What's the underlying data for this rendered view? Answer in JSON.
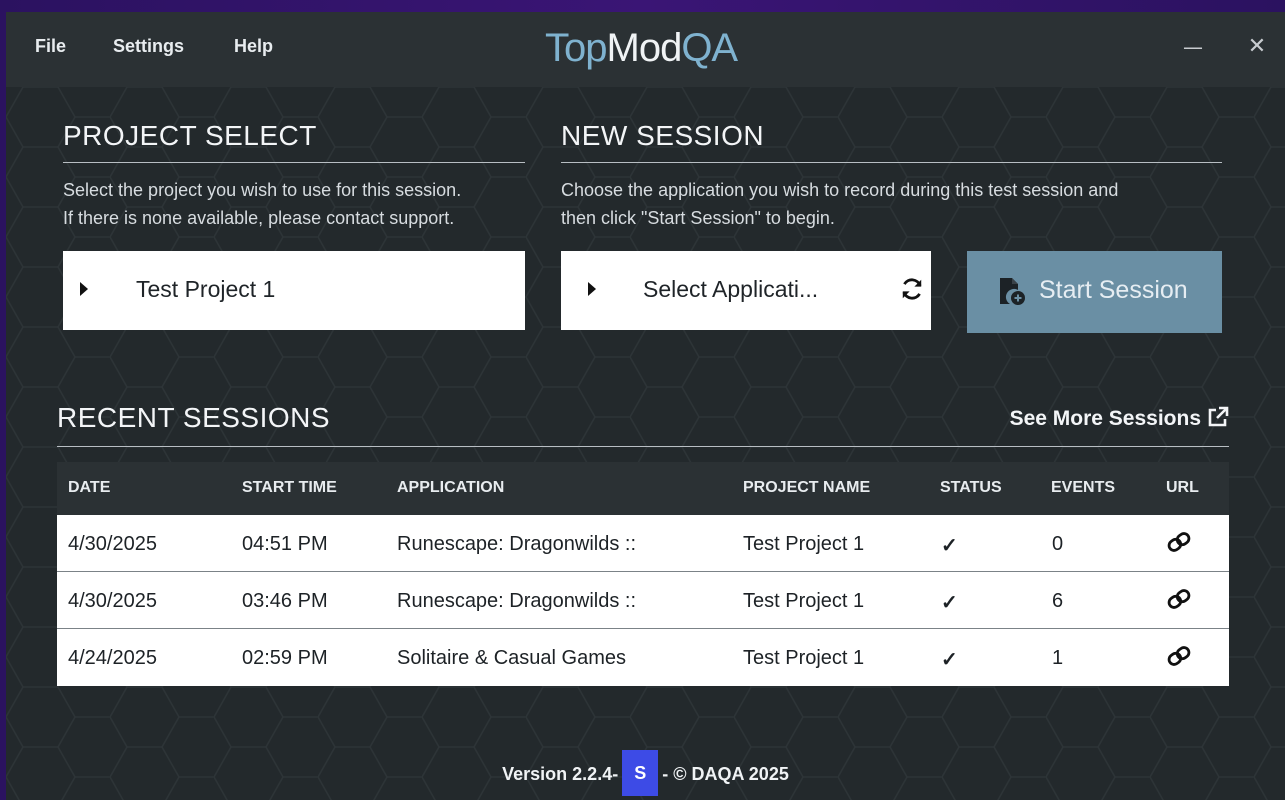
{
  "app": {
    "logo_part1": "Top",
    "logo_part2": "Mod",
    "logo_part3": "QA"
  },
  "menu": {
    "file": "File",
    "settings": "Settings",
    "help": "Help"
  },
  "window_controls": {
    "minimize": "—",
    "close": "✕"
  },
  "project_select": {
    "title": "PROJECT SELECT",
    "desc_line1": "Select the project you wish to use for this session.",
    "desc_line2": "If there is none available, please contact support.",
    "selected": "Test Project 1"
  },
  "new_session": {
    "title": "NEW SESSION",
    "desc_line1": "Choose the application you wish to record during this test session and",
    "desc_line2": "then click \"Start Session\" to begin.",
    "app_selected": "Select Applicati...",
    "start_label": "Start Session",
    "start_button_color": "#6a8fa4"
  },
  "recent_sessions": {
    "title": "RECENT SESSIONS",
    "see_more": "See More Sessions",
    "columns": [
      "DATE",
      "START TIME",
      "APPLICATION",
      "PROJECT NAME",
      "STATUS",
      "EVENTS",
      "URL"
    ],
    "rows": [
      {
        "date": "4/30/2025",
        "start_time": "04:51 PM",
        "application": "Runescape: Dragonwilds ::",
        "project": "Test Project 1",
        "status": "✓",
        "events": "0"
      },
      {
        "date": "4/30/2025",
        "start_time": "03:46 PM",
        "application": "Runescape: Dragonwilds ::",
        "project": "Test Project 1",
        "status": "✓",
        "events": "6"
      },
      {
        "date": "4/24/2025",
        "start_time": "02:59 PM",
        "application": "Solitaire & Casual Games",
        "project": "Test Project 1",
        "status": "✓",
        "events": "1"
      }
    ]
  },
  "footer": {
    "version": "Version 2.2.4-",
    "badge": "S",
    "copyright": "- © DAQA 2025",
    "badge_color": "#3d4be6"
  }
}
